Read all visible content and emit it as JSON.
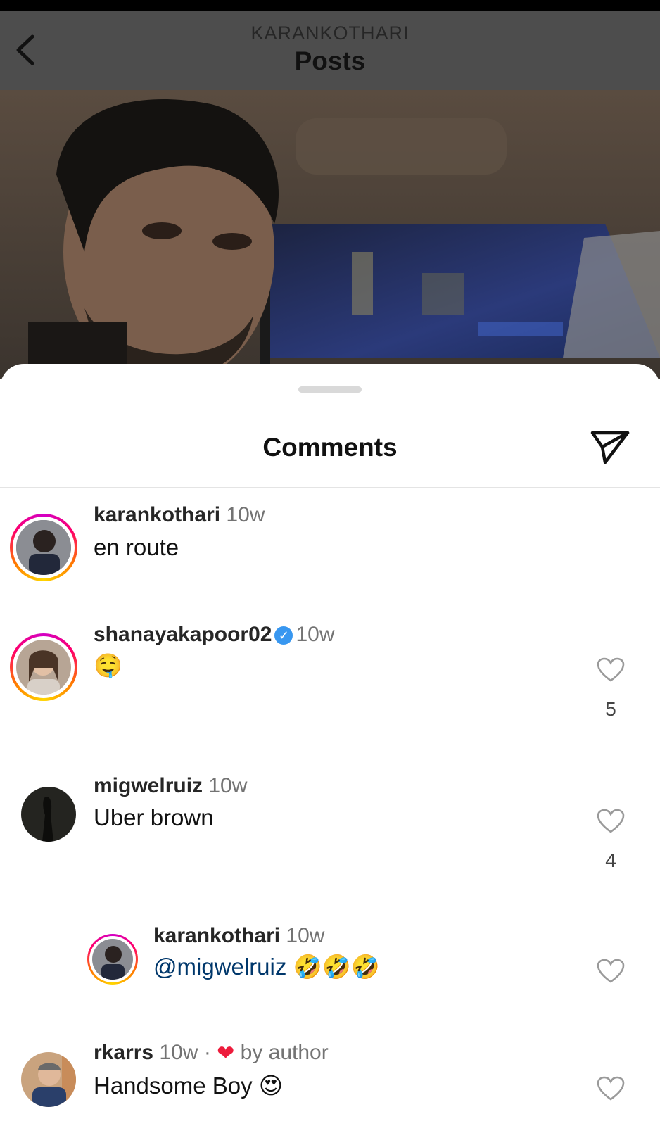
{
  "header": {
    "subtitle": "KARANKOTHARI",
    "title": "Posts"
  },
  "comments_sheet": {
    "title": "Comments",
    "items": [
      {
        "username": "karankothari",
        "time": "10w",
        "text": "en route"
      },
      {
        "username": "shanayakapoor02",
        "verified": true,
        "time": "10w",
        "text": "🤤",
        "likes": "5"
      },
      {
        "username": "migwelruiz",
        "time": "10w",
        "text": "Uber brown",
        "likes": "4"
      },
      {
        "username": "karankothari",
        "time": "10w",
        "mention": "@migwelruiz",
        "text": "🤣🤣🤣"
      },
      {
        "username": "rkarrs",
        "time": "10w",
        "separator": "·",
        "liked_by": "by author",
        "text": "Handsome Boy",
        "emoji": "😍"
      }
    ]
  },
  "colors": {
    "header_bg": "#4d4d4d",
    "mention": "#00376b",
    "verified": "#3897f0",
    "heart_red": "#ed1c3c"
  },
  "icons": [
    "chevron-left-icon",
    "send-icon",
    "heart-outline-icon",
    "verified-badge-icon",
    "heart-filled-icon"
  ]
}
